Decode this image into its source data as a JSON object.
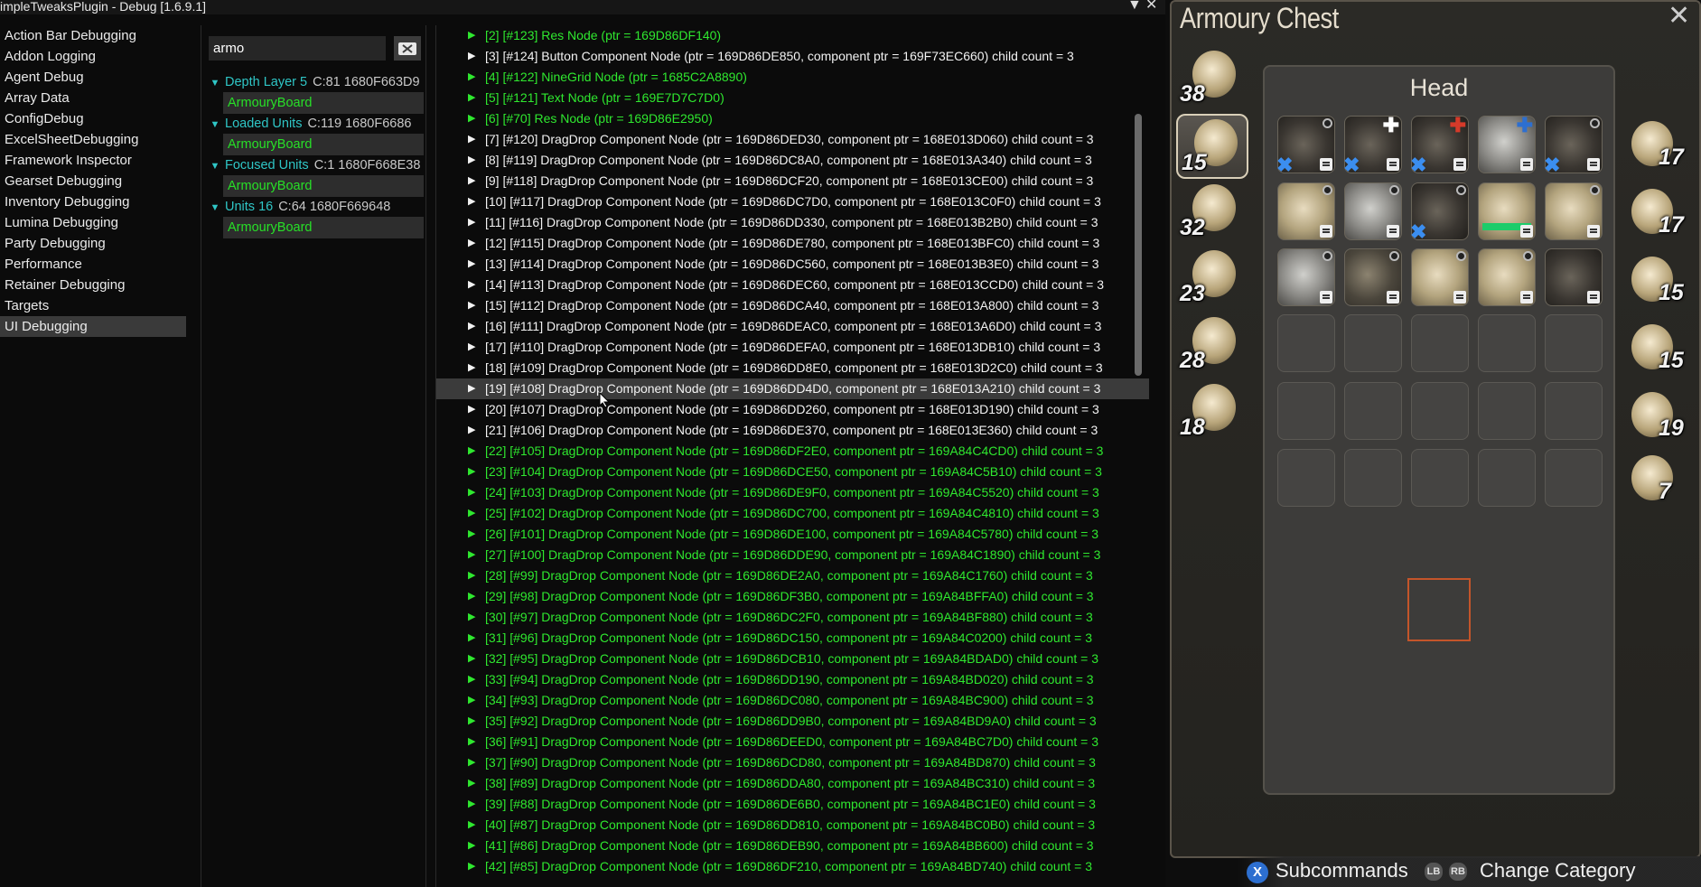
{
  "window": {
    "title": "impleTweaksPlugin - Debug [1.6.9.1]",
    "collapse_glyph": "▼",
    "close_glyph": "✕"
  },
  "nav": {
    "items": [
      "Action Bar Debugging",
      "Addon Logging",
      "Agent Debug",
      "Array Data",
      "ConfigDebug",
      "ExcelSheetDebugging",
      "Framework Inspector",
      "Gearset Debugging",
      "Inventory Debugging",
      "Lumina Debugging",
      "Party Debugging",
      "Performance",
      "Retainer Debugging",
      "Targets",
      "UI Debugging"
    ],
    "selected": "UI Debugging"
  },
  "search": {
    "value": "armo",
    "button_icon": "search-clear-icon"
  },
  "units": [
    {
      "name": "Depth Layer 5",
      "meta": "C:81  1680F663D9",
      "child": "ArmouryBoard"
    },
    {
      "name": "Loaded Units",
      "meta": "C:119  1680F6686",
      "child": "ArmouryBoard"
    },
    {
      "name": "Focused Units",
      "meta": "C:1  1680F668E38",
      "child": "ArmouryBoard"
    },
    {
      "name": "Units 16",
      "meta": "C:64  1680F669648",
      "child": "ArmouryBoard"
    }
  ],
  "tree": {
    "rows": [
      {
        "text": "[2] [#123] Res Node (ptr = 169D86DF140)",
        "color": "green"
      },
      {
        "text": "[3] [#124] Button Component Node (ptr = 169D86DE850, component ptr = 169F73EC660) child count = 3",
        "color": "white"
      },
      {
        "text": "[4] [#122] NineGrid Node (ptr = 1685C2A8890)",
        "color": "green"
      },
      {
        "text": "[5] [#121] Text Node (ptr = 169E7D7C7D0)",
        "color": "green"
      },
      {
        "text": "[6] [#70] Res Node (ptr = 169D86E2950)",
        "color": "green"
      },
      {
        "text": "[7] [#120] DragDrop Component Node (ptr = 169D86DED30, component ptr = 168E013D060) child count = 3",
        "color": "white"
      },
      {
        "text": "[8] [#119] DragDrop Component Node (ptr = 169D86DC8A0, component ptr = 168E013A340) child count = 3",
        "color": "white"
      },
      {
        "text": "[9] [#118] DragDrop Component Node (ptr = 169D86DCF20, component ptr = 168E013CE00) child count = 3",
        "color": "white"
      },
      {
        "text": "[10] [#117] DragDrop Component Node (ptr = 169D86DC7D0, component ptr = 168E013C0F0) child count = 3",
        "color": "white"
      },
      {
        "text": "[11] [#116] DragDrop Component Node (ptr = 169D86DD330, component ptr = 168E013B2B0) child count = 3",
        "color": "white"
      },
      {
        "text": "[12] [#115] DragDrop Component Node (ptr = 169D86DE780, component ptr = 168E013BFC0) child count = 3",
        "color": "white"
      },
      {
        "text": "[13] [#114] DragDrop Component Node (ptr = 169D86DC560, component ptr = 168E013B3E0) child count = 3",
        "color": "white"
      },
      {
        "text": "[14] [#113] DragDrop Component Node (ptr = 169D86DEC60, component ptr = 168E013CCD0) child count = 3",
        "color": "white"
      },
      {
        "text": "[15] [#112] DragDrop Component Node (ptr = 169D86DCA40, component ptr = 168E013A800) child count = 3",
        "color": "white"
      },
      {
        "text": "[16] [#111] DragDrop Component Node (ptr = 169D86DEAC0, component ptr = 168E013A6D0) child count = 3",
        "color": "white"
      },
      {
        "text": "[17] [#110] DragDrop Component Node (ptr = 169D86DEFA0, component ptr = 168E013DB10) child count = 3",
        "color": "white"
      },
      {
        "text": "[18] [#109] DragDrop Component Node (ptr = 169D86DD8E0, component ptr = 168E013D2C0) child count = 3",
        "color": "white"
      },
      {
        "text": "[19] [#108] DragDrop Component Node (ptr = 169D86DD4D0, component ptr = 168E013A210) child count = 3",
        "color": "white",
        "hover": true
      },
      {
        "text": "[20] [#107] DragDrop Component Node (ptr = 169D86DD260, component ptr = 168E013D190) child count = 3",
        "color": "white"
      },
      {
        "text": "[21] [#106] DragDrop Component Node (ptr = 169D86DE370, component ptr = 168E013E360) child count = 3",
        "color": "white"
      },
      {
        "text": "[22] [#105] DragDrop Component Node (ptr = 169D86DF2E0, component ptr = 169A84C4CD0) child count = 3",
        "color": "green"
      },
      {
        "text": "[23] [#104] DragDrop Component Node (ptr = 169D86DCE50, component ptr = 169A84C5B10) child count = 3",
        "color": "green"
      },
      {
        "text": "[24] [#103] DragDrop Component Node (ptr = 169D86DE9F0, component ptr = 169A84C5520) child count = 3",
        "color": "green"
      },
      {
        "text": "[25] [#102] DragDrop Component Node (ptr = 169D86DC700, component ptr = 169A84C4810) child count = 3",
        "color": "green"
      },
      {
        "text": "[26] [#101] DragDrop Component Node (ptr = 169D86DE100, component ptr = 169A84C5780) child count = 3",
        "color": "green"
      },
      {
        "text": "[27] [#100] DragDrop Component Node (ptr = 169D86DDE90, component ptr = 169A84C1890) child count = 3",
        "color": "green"
      },
      {
        "text": "[28] [#99] DragDrop Component Node (ptr = 169D86DE2A0, component ptr = 169A84C1760) child count = 3",
        "color": "green"
      },
      {
        "text": "[29] [#98] DragDrop Component Node (ptr = 169D86DF3B0, component ptr = 169A84BFFA0) child count = 3",
        "color": "green"
      },
      {
        "text": "[30] [#97] DragDrop Component Node (ptr = 169D86DC2F0, component ptr = 169A84BF880) child count = 3",
        "color": "green"
      },
      {
        "text": "[31] [#96] DragDrop Component Node (ptr = 169D86DC150, component ptr = 169A84C0200) child count = 3",
        "color": "green"
      },
      {
        "text": "[32] [#95] DragDrop Component Node (ptr = 169D86DCB10, component ptr = 169A84BDAD0) child count = 3",
        "color": "green"
      },
      {
        "text": "[33] [#94] DragDrop Component Node (ptr = 169D86DD190, component ptr = 169A84BD020) child count = 3",
        "color": "green"
      },
      {
        "text": "[34] [#93] DragDrop Component Node (ptr = 169D86DC080, component ptr = 169A84BC900) child count = 3",
        "color": "green"
      },
      {
        "text": "[35] [#92] DragDrop Component Node (ptr = 169D86DD9B0, component ptr = 169A84BD9A0) child count = 3",
        "color": "green"
      },
      {
        "text": "[36] [#91] DragDrop Component Node (ptr = 169D86DEED0, component ptr = 169A84BC7D0) child count = 3",
        "color": "green"
      },
      {
        "text": "[37] [#90] DragDrop Component Node (ptr = 169D86DCD80, component ptr = 169A84BD870) child count = 3",
        "color": "green"
      },
      {
        "text": "[38] [#89] DragDrop Component Node (ptr = 169D86DDA80, component ptr = 169A84BC310) child count = 3",
        "color": "green"
      },
      {
        "text": "[39] [#88] DragDrop Component Node (ptr = 169D86DE6B0, component ptr = 169A84BC1E0) child count = 3",
        "color": "green"
      },
      {
        "text": "[40] [#87] DragDrop Component Node (ptr = 169D86DD810, component ptr = 169A84BC0B0) child count = 3",
        "color": "green"
      },
      {
        "text": "[41] [#86] DragDrop Component Node (ptr = 169D86DEB90, component ptr = 169A84BB600) child count = 3",
        "color": "green"
      },
      {
        "text": "[42] [#85] DragDrop Component Node (ptr = 169D86DF210, component ptr = 169A84BD740) child count = 3",
        "color": "green"
      }
    ]
  },
  "armoury": {
    "title": "Armoury Chest",
    "category": "Head",
    "close_glyph": "✕",
    "left_categories": [
      {
        "icon": "sword-icon",
        "count": "38"
      },
      {
        "icon": "helmet-icon",
        "count": "15",
        "selected": true
      },
      {
        "icon": "body-armor-icon",
        "count": "32"
      },
      {
        "icon": "gloves-icon",
        "count": "23"
      },
      {
        "icon": "legs-icon",
        "count": "28"
      },
      {
        "icon": "boots-icon",
        "count": "18"
      }
    ],
    "right_categories": [
      {
        "icon": "offhand-shield-icon",
        "count": "17"
      },
      {
        "icon": "earring-icon",
        "count": "17"
      },
      {
        "icon": "necklace-icon",
        "count": "15"
      },
      {
        "icon": "bracelet-icon",
        "count": "15"
      },
      {
        "icon": "ring-icon",
        "count": "19"
      },
      {
        "icon": "soul-crystal-icon",
        "count": "7"
      }
    ],
    "hints": {
      "x_button": "X",
      "subcommands": "Subcommands",
      "lb": "LB",
      "rb": "RB",
      "change_category": "Change Category"
    }
  }
}
